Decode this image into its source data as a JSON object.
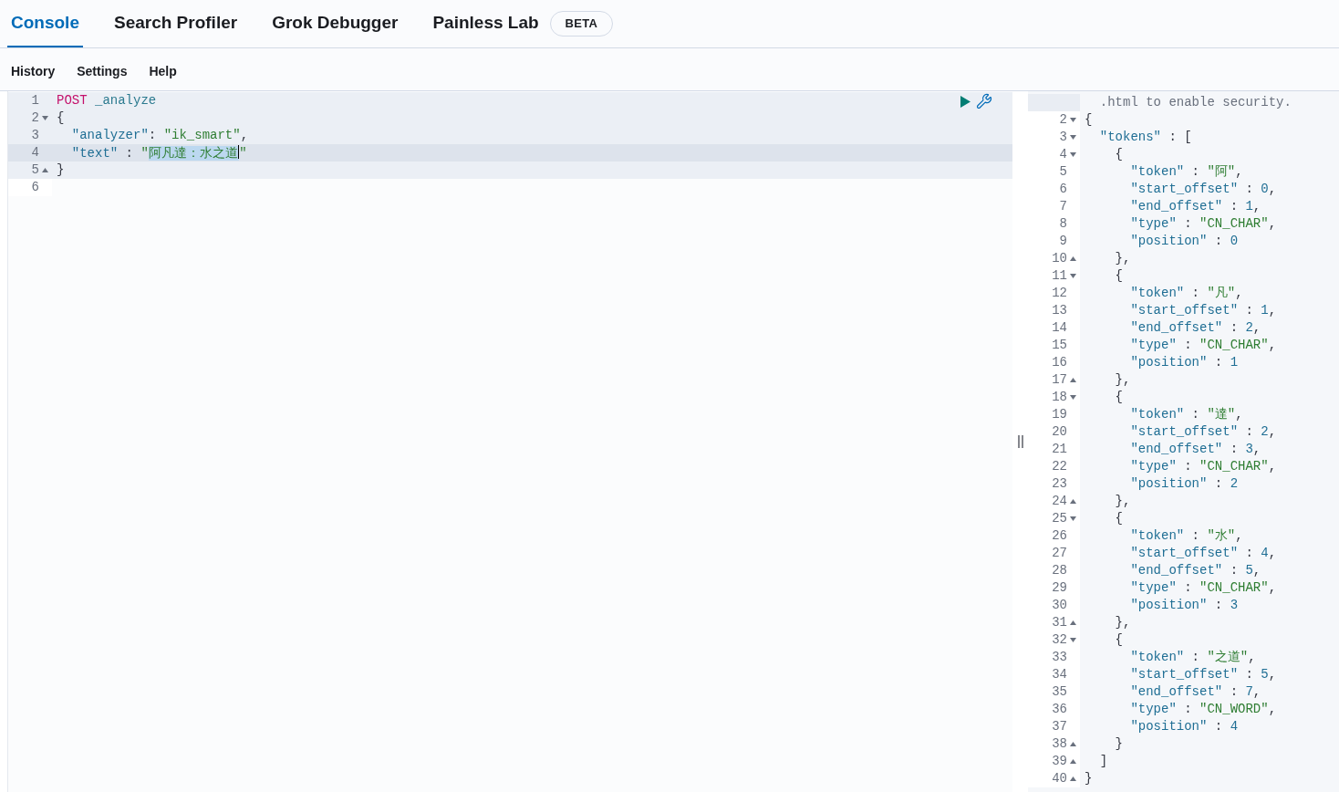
{
  "tabs": [
    {
      "label": "Console",
      "selected": true
    },
    {
      "label": "Search Profiler",
      "selected": false
    },
    {
      "label": "Grok Debugger",
      "selected": false
    },
    {
      "label": "Painless Lab",
      "selected": false,
      "badge": "BETA"
    }
  ],
  "menu": [
    "History",
    "Settings",
    "Help"
  ],
  "request_editor": {
    "lines": [
      {
        "number": "1",
        "active": false,
        "in_request": true,
        "tokens": [
          {
            "kind": "method",
            "text": "POST"
          },
          {
            "kind": "path",
            "text": " _analyze"
          }
        ]
      },
      {
        "number": "2",
        "fold_start": true,
        "active": false,
        "in_request": true,
        "tokens": [
          {
            "kind": "punct",
            "text": "{"
          }
        ]
      },
      {
        "number": "3",
        "active": false,
        "in_request": true,
        "tokens": [
          {
            "kind": "key",
            "text": "  \"analyzer\""
          },
          {
            "kind": "punct",
            "text": ": "
          },
          {
            "kind": "string",
            "text": "\"ik_smart\""
          },
          {
            "kind": "punct",
            "text": ","
          }
        ]
      },
      {
        "number": "4",
        "active": true,
        "in_request": true,
        "tokens": [
          {
            "kind": "key",
            "text": "  \"text\""
          },
          {
            "kind": "punct",
            "text": " : "
          },
          {
            "kind": "string",
            "text": "\""
          },
          {
            "kind": "string",
            "text": "阿凡達：水之道",
            "selected": true,
            "cursor": true
          },
          {
            "kind": "string",
            "text": "\""
          }
        ]
      },
      {
        "number": "5",
        "fold_end": true,
        "active": false,
        "in_request": true,
        "tokens": [
          {
            "kind": "punct",
            "text": "}"
          }
        ]
      },
      {
        "number": "6",
        "active": false,
        "in_request": false
      }
    ]
  },
  "response_viewer": {
    "lines": [
      {
        "tokens": [
          {
            "kind": "comment",
            "text": "  .html to enable security."
          }
        ]
      },
      {
        "number": "2",
        "fold_start": true,
        "tokens": [
          {
            "kind": "punct",
            "text": "{"
          }
        ]
      },
      {
        "number": "3",
        "fold_start": true,
        "tokens": [
          {
            "kind": "key",
            "text": "  \"tokens\""
          },
          {
            "kind": "punct",
            "text": " : ["
          }
        ]
      },
      {
        "number": "4",
        "fold_start": true,
        "tokens": [
          {
            "kind": "punct",
            "text": "    {"
          }
        ]
      },
      {
        "number": "5",
        "tokens": [
          {
            "kind": "key",
            "text": "      \"token\""
          },
          {
            "kind": "punct",
            "text": " : "
          },
          {
            "kind": "string",
            "text": "\"阿\""
          },
          {
            "kind": "punct",
            "text": ","
          }
        ]
      },
      {
        "number": "6",
        "tokens": [
          {
            "kind": "key",
            "text": "      \"start_offset\""
          },
          {
            "kind": "punct",
            "text": " : "
          },
          {
            "kind": "number",
            "text": "0"
          },
          {
            "kind": "punct",
            "text": ","
          }
        ]
      },
      {
        "number": "7",
        "tokens": [
          {
            "kind": "key",
            "text": "      \"end_offset\""
          },
          {
            "kind": "punct",
            "text": " : "
          },
          {
            "kind": "number",
            "text": "1"
          },
          {
            "kind": "punct",
            "text": ","
          }
        ]
      },
      {
        "number": "8",
        "tokens": [
          {
            "kind": "key",
            "text": "      \"type\""
          },
          {
            "kind": "punct",
            "text": " : "
          },
          {
            "kind": "string",
            "text": "\"CN_CHAR\""
          },
          {
            "kind": "punct",
            "text": ","
          }
        ]
      },
      {
        "number": "9",
        "tokens": [
          {
            "kind": "key",
            "text": "      \"position\""
          },
          {
            "kind": "punct",
            "text": " : "
          },
          {
            "kind": "number",
            "text": "0"
          }
        ]
      },
      {
        "number": "10",
        "fold_end": true,
        "tokens": [
          {
            "kind": "punct",
            "text": "    },"
          }
        ]
      },
      {
        "number": "11",
        "fold_start": true,
        "tokens": [
          {
            "kind": "punct",
            "text": "    {"
          }
        ]
      },
      {
        "number": "12",
        "tokens": [
          {
            "kind": "key",
            "text": "      \"token\""
          },
          {
            "kind": "punct",
            "text": " : "
          },
          {
            "kind": "string",
            "text": "\"凡\""
          },
          {
            "kind": "punct",
            "text": ","
          }
        ]
      },
      {
        "number": "13",
        "tokens": [
          {
            "kind": "key",
            "text": "      \"start_offset\""
          },
          {
            "kind": "punct",
            "text": " : "
          },
          {
            "kind": "number",
            "text": "1"
          },
          {
            "kind": "punct",
            "text": ","
          }
        ]
      },
      {
        "number": "14",
        "tokens": [
          {
            "kind": "key",
            "text": "      \"end_offset\""
          },
          {
            "kind": "punct",
            "text": " : "
          },
          {
            "kind": "number",
            "text": "2"
          },
          {
            "kind": "punct",
            "text": ","
          }
        ]
      },
      {
        "number": "15",
        "tokens": [
          {
            "kind": "key",
            "text": "      \"type\""
          },
          {
            "kind": "punct",
            "text": " : "
          },
          {
            "kind": "string",
            "text": "\"CN_CHAR\""
          },
          {
            "kind": "punct",
            "text": ","
          }
        ]
      },
      {
        "number": "16",
        "tokens": [
          {
            "kind": "key",
            "text": "      \"position\""
          },
          {
            "kind": "punct",
            "text": " : "
          },
          {
            "kind": "number",
            "text": "1"
          }
        ]
      },
      {
        "number": "17",
        "fold_end": true,
        "tokens": [
          {
            "kind": "punct",
            "text": "    },"
          }
        ]
      },
      {
        "number": "18",
        "fold_start": true,
        "tokens": [
          {
            "kind": "punct",
            "text": "    {"
          }
        ]
      },
      {
        "number": "19",
        "tokens": [
          {
            "kind": "key",
            "text": "      \"token\""
          },
          {
            "kind": "punct",
            "text": " : "
          },
          {
            "kind": "string",
            "text": "\"達\""
          },
          {
            "kind": "punct",
            "text": ","
          }
        ]
      },
      {
        "number": "20",
        "tokens": [
          {
            "kind": "key",
            "text": "      \"start_offset\""
          },
          {
            "kind": "punct",
            "text": " : "
          },
          {
            "kind": "number",
            "text": "2"
          },
          {
            "kind": "punct",
            "text": ","
          }
        ]
      },
      {
        "number": "21",
        "tokens": [
          {
            "kind": "key",
            "text": "      \"end_offset\""
          },
          {
            "kind": "punct",
            "text": " : "
          },
          {
            "kind": "number",
            "text": "3"
          },
          {
            "kind": "punct",
            "text": ","
          }
        ]
      },
      {
        "number": "22",
        "tokens": [
          {
            "kind": "key",
            "text": "      \"type\""
          },
          {
            "kind": "punct",
            "text": " : "
          },
          {
            "kind": "string",
            "text": "\"CN_CHAR\""
          },
          {
            "kind": "punct",
            "text": ","
          }
        ]
      },
      {
        "number": "23",
        "tokens": [
          {
            "kind": "key",
            "text": "      \"position\""
          },
          {
            "kind": "punct",
            "text": " : "
          },
          {
            "kind": "number",
            "text": "2"
          }
        ]
      },
      {
        "number": "24",
        "fold_end": true,
        "tokens": [
          {
            "kind": "punct",
            "text": "    },"
          }
        ]
      },
      {
        "number": "25",
        "fold_start": true,
        "tokens": [
          {
            "kind": "punct",
            "text": "    {"
          }
        ]
      },
      {
        "number": "26",
        "tokens": [
          {
            "kind": "key",
            "text": "      \"token\""
          },
          {
            "kind": "punct",
            "text": " : "
          },
          {
            "kind": "string",
            "text": "\"水\""
          },
          {
            "kind": "punct",
            "text": ","
          }
        ]
      },
      {
        "number": "27",
        "tokens": [
          {
            "kind": "key",
            "text": "      \"start_offset\""
          },
          {
            "kind": "punct",
            "text": " : "
          },
          {
            "kind": "number",
            "text": "4"
          },
          {
            "kind": "punct",
            "text": ","
          }
        ]
      },
      {
        "number": "28",
        "tokens": [
          {
            "kind": "key",
            "text": "      \"end_offset\""
          },
          {
            "kind": "punct",
            "text": " : "
          },
          {
            "kind": "number",
            "text": "5"
          },
          {
            "kind": "punct",
            "text": ","
          }
        ]
      },
      {
        "number": "29",
        "tokens": [
          {
            "kind": "key",
            "text": "      \"type\""
          },
          {
            "kind": "punct",
            "text": " : "
          },
          {
            "kind": "string",
            "text": "\"CN_CHAR\""
          },
          {
            "kind": "punct",
            "text": ","
          }
        ]
      },
      {
        "number": "30",
        "tokens": [
          {
            "kind": "key",
            "text": "      \"position\""
          },
          {
            "kind": "punct",
            "text": " : "
          },
          {
            "kind": "number",
            "text": "3"
          }
        ]
      },
      {
        "number": "31",
        "fold_end": true,
        "tokens": [
          {
            "kind": "punct",
            "text": "    },"
          }
        ]
      },
      {
        "number": "32",
        "fold_start": true,
        "tokens": [
          {
            "kind": "punct",
            "text": "    {"
          }
        ]
      },
      {
        "number": "33",
        "tokens": [
          {
            "kind": "key",
            "text": "      \"token\""
          },
          {
            "kind": "punct",
            "text": " : "
          },
          {
            "kind": "string",
            "text": "\"之道\""
          },
          {
            "kind": "punct",
            "text": ","
          }
        ]
      },
      {
        "number": "34",
        "tokens": [
          {
            "kind": "key",
            "text": "      \"start_offset\""
          },
          {
            "kind": "punct",
            "text": " : "
          },
          {
            "kind": "number",
            "text": "5"
          },
          {
            "kind": "punct",
            "text": ","
          }
        ]
      },
      {
        "number": "35",
        "tokens": [
          {
            "kind": "key",
            "text": "      \"end_offset\""
          },
          {
            "kind": "punct",
            "text": " : "
          },
          {
            "kind": "number",
            "text": "7"
          },
          {
            "kind": "punct",
            "text": ","
          }
        ]
      },
      {
        "number": "36",
        "tokens": [
          {
            "kind": "key",
            "text": "      \"type\""
          },
          {
            "kind": "punct",
            "text": " : "
          },
          {
            "kind": "string",
            "text": "\"CN_WORD\""
          },
          {
            "kind": "punct",
            "text": ","
          }
        ]
      },
      {
        "number": "37",
        "tokens": [
          {
            "kind": "key",
            "text": "      \"position\""
          },
          {
            "kind": "punct",
            "text": " : "
          },
          {
            "kind": "number",
            "text": "4"
          }
        ]
      },
      {
        "number": "38",
        "fold_end": true,
        "tokens": [
          {
            "kind": "punct",
            "text": "    }"
          }
        ]
      },
      {
        "number": "39",
        "fold_end": true,
        "tokens": [
          {
            "kind": "punct",
            "text": "  ]"
          }
        ]
      },
      {
        "number": "40",
        "fold_end": true,
        "tokens": [
          {
            "kind": "punct",
            "text": "}"
          }
        ]
      }
    ]
  }
}
